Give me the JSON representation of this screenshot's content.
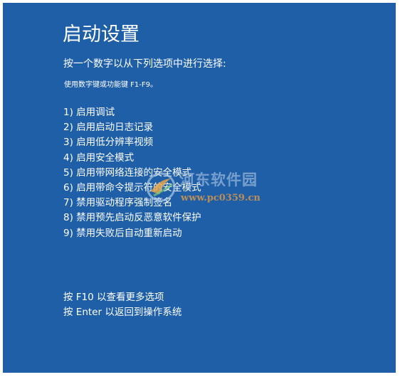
{
  "screen": {
    "background": "#1f5fa8",
    "text_color": "#ffffff"
  },
  "title": "启动设置",
  "instruction": "按一个数字以从下列选项中进行选择:",
  "hint": "使用数字键或功能键 F1-F9。",
  "options": [
    "1) 启用调试",
    "2) 启用启动日志记录",
    "3) 启用低分辨率视频",
    "4) 启用安全模式",
    "5) 启用带网络连接的安全模式",
    "6) 启用带命令提示符的安全模式",
    "7) 禁用驱动程序强制签名",
    "8) 禁用预先启动反恶意软件保护",
    "9) 禁用失败后自动重新启动"
  ],
  "footer": {
    "more_options": "按 F10 以查看更多选项",
    "return": "按 Enter 以返回到操作系统"
  },
  "watermark": {
    "name": "河东软件园",
    "url": "www.pc0359.cn",
    "icon": "watermark-logo-icon"
  }
}
